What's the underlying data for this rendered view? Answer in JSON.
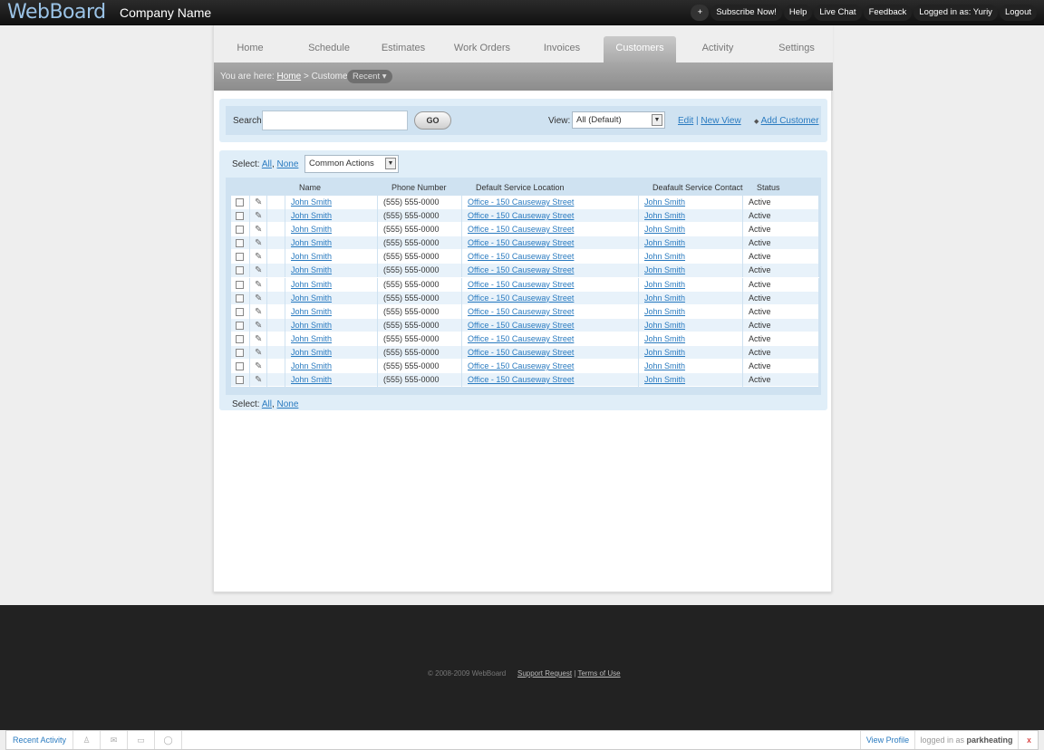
{
  "app": {
    "logo": "WebBoard",
    "company": "Company Name"
  },
  "topnav": {
    "plus": "+",
    "subscribe": "Subscribe Now!",
    "help": "Help",
    "live_chat": "Live Chat",
    "feedback": "Feedback",
    "logged_in": "Logged in as: Yuriy",
    "logout": "Logout"
  },
  "tabs": [
    "Home",
    "Schedule",
    "Estimates",
    "Work Orders",
    "Invoices",
    "Customers",
    "Activity",
    "Settings"
  ],
  "active_tab": "Customers",
  "breadcrumb": {
    "prefix": "You are here:",
    "home": "Home",
    "sep": ">",
    "current": "Customers",
    "recent": "Recent"
  },
  "search": {
    "label": "Search:",
    "value": "",
    "go": "GO",
    "view_label": "View:",
    "view_value": "All (Default)",
    "edit": "Edit",
    "pipe": "|",
    "new_view": "New View",
    "add_customer": "Add Customer"
  },
  "select": {
    "label": "Select:",
    "all": "All",
    "comma": ",",
    "none": "None",
    "common_actions": "Common Actions"
  },
  "table": {
    "headers": [
      "Name",
      "Phone Number",
      "Default Service Location",
      "Deafault Service Contact",
      "Status"
    ],
    "rows": [
      {
        "name": "John Smith",
        "phone": "(555) 555-0000",
        "location": "Office - 150 Causeway Street",
        "contact": "John Smith",
        "status": "Active"
      },
      {
        "name": "John Smith",
        "phone": "(555) 555-0000",
        "location": "Office - 150 Causeway Street",
        "contact": "John Smith",
        "status": "Active"
      },
      {
        "name": "John Smith",
        "phone": "(555) 555-0000",
        "location": "Office - 150 Causeway Street",
        "contact": "John Smith",
        "status": "Active"
      },
      {
        "name": "John Smith",
        "phone": "(555) 555-0000",
        "location": "Office - 150 Causeway Street",
        "contact": "John Smith",
        "status": "Active"
      },
      {
        "name": "John Smith",
        "phone": "(555) 555-0000",
        "location": "Office - 150 Causeway Street",
        "contact": "John Smith",
        "status": "Active"
      },
      {
        "name": "John Smith",
        "phone": "(555) 555-0000",
        "location": "Office - 150 Causeway Street",
        "contact": "John Smith",
        "status": "Active"
      },
      {
        "name": "John Smith",
        "phone": "(555) 555-0000",
        "location": "Office - 150 Causeway Street",
        "contact": "John Smith",
        "status": "Active"
      },
      {
        "name": "John Smith",
        "phone": "(555) 555-0000",
        "location": "Office - 150 Causeway Street",
        "contact": "John Smith",
        "status": "Active"
      },
      {
        "name": "John Smith",
        "phone": "(555) 555-0000",
        "location": "Office - 150 Causeway Street",
        "contact": "John Smith",
        "status": "Active"
      },
      {
        "name": "John Smith",
        "phone": "(555) 555-0000",
        "location": "Office - 150 Causeway Street",
        "contact": "John Smith",
        "status": "Active"
      },
      {
        "name": "John Smith",
        "phone": "(555) 555-0000",
        "location": "Office - 150 Causeway Street",
        "contact": "John Smith",
        "status": "Active"
      },
      {
        "name": "John Smith",
        "phone": "(555) 555-0000",
        "location": "Office - 150 Causeway Street",
        "contact": "John Smith",
        "status": "Active"
      },
      {
        "name": "John Smith",
        "phone": "(555) 555-0000",
        "location": "Office - 150 Causeway Street",
        "contact": "John Smith",
        "status": "Active"
      },
      {
        "name": "John Smith",
        "phone": "(555) 555-0000",
        "location": "Office - 150 Causeway Street",
        "contact": "John Smith",
        "status": "Active"
      }
    ]
  },
  "footer": {
    "copyright": "© 2008-2009 WebBoard",
    "support": "Support Request",
    "sep": "|",
    "terms": "Terms of Use"
  },
  "bottombar": {
    "recent_activity": "Recent Activity",
    "icons": [
      "user-icon",
      "mail-icon",
      "card-icon",
      "chat-icon"
    ],
    "view_profile": "View Profile",
    "logged_prefix": "logged in as",
    "username": "parkheating",
    "close": "x"
  },
  "colors": {
    "link": "#2a7bc0",
    "topbar": "#1a1a1a",
    "panel": "#e0eef8",
    "footer": "#222222"
  }
}
